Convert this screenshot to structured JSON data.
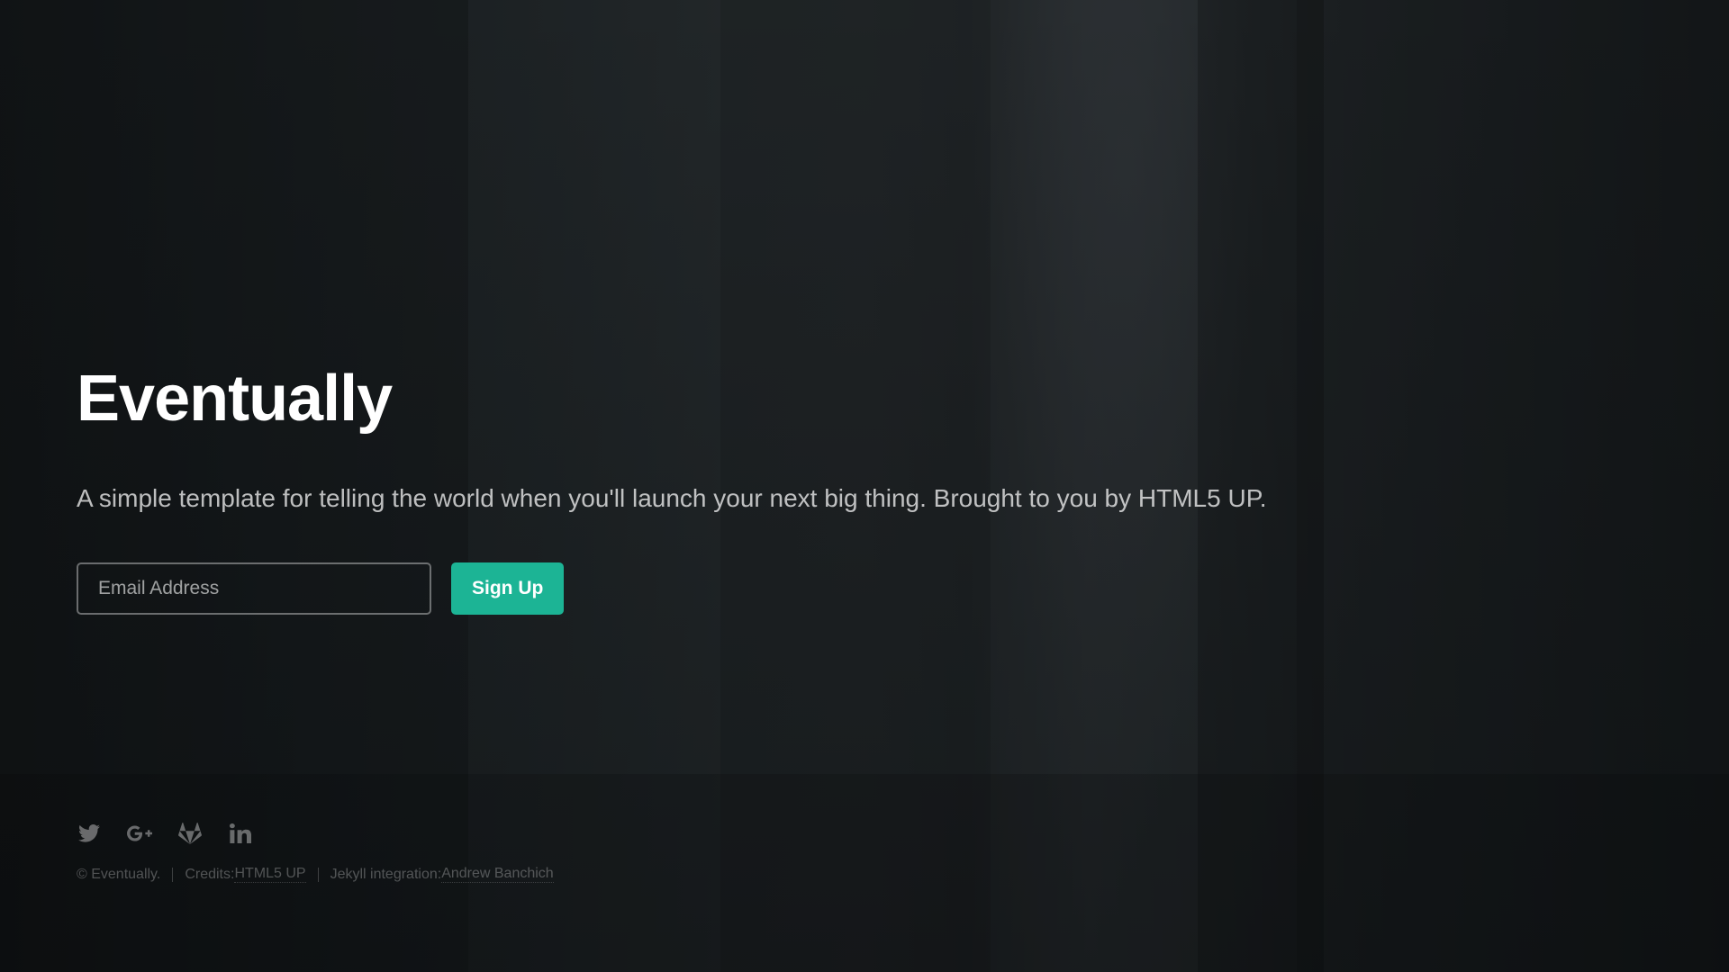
{
  "hero": {
    "title": "Eventually",
    "tagline": "A simple template for telling the world when you'll launch your next big thing. Brought to you by HTML5 UP."
  },
  "form": {
    "email_placeholder": "Email Address",
    "submit_label": "Sign Up"
  },
  "social": [
    {
      "icon": "twitter-icon"
    },
    {
      "icon": "google-plus-icon"
    },
    {
      "icon": "gitlab-icon"
    },
    {
      "icon": "linkedin-icon"
    }
  ],
  "footer": {
    "copyright": "© Eventually.",
    "credits_prefix": "Credits: ",
    "credits_link": "HTML5 UP",
    "jekyll_prefix": "Jekyll integration: ",
    "jekyll_link": "Andrew Banchich"
  },
  "colors": {
    "accent": "#1cb495",
    "text": "#ffffff"
  }
}
